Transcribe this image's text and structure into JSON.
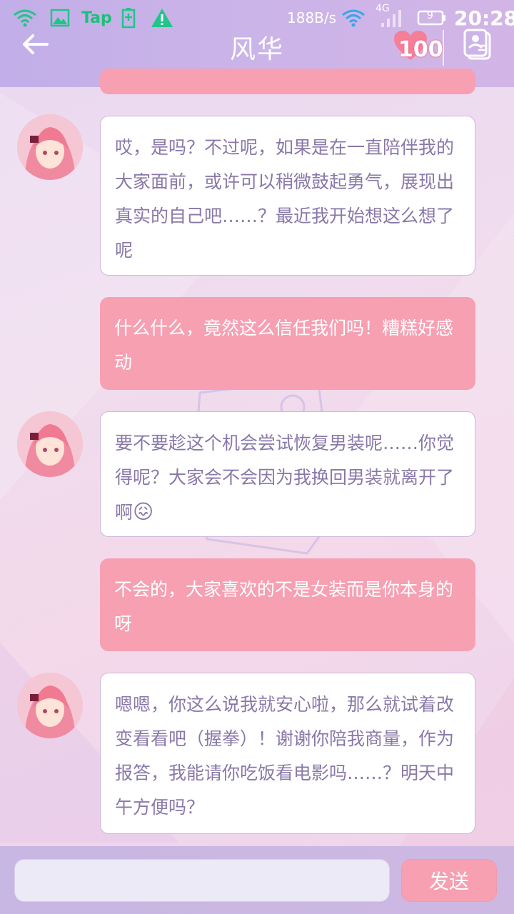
{
  "status_bar": {
    "tap_label": "Tap",
    "net_speed": "188B/s",
    "network_type": "4G",
    "battery_level": "9",
    "time": "20:28",
    "icons": [
      "wifi-icon",
      "image-icon",
      "tap-icon",
      "battery-charge-icon",
      "warning-icon",
      "wifi-icon",
      "signal-icon",
      "battery-icon"
    ]
  },
  "header": {
    "title": "风华",
    "heart_count": "100"
  },
  "messages": [
    {
      "side": "in",
      "text": "哎，是吗？不过呢，如果是在一直陪伴我的大家面前，或许可以稍微鼓起勇气，展现出真实的自己吧……？最近我开始想这么想了呢"
    },
    {
      "side": "out",
      "text": "什么什么，竟然这么信任我们吗！糟糕好感动"
    },
    {
      "side": "in",
      "text": "要不要趁这个机会尝试恢复男装呢……你觉得呢？大家会不会因为我换回男装就离开了啊",
      "emoji": "😖"
    },
    {
      "side": "out",
      "text": "不会的，大家喜欢的不是女装而是你本身的呀"
    },
    {
      "side": "in",
      "text": "嗯嗯，你这么说我就安心啦，那么就试着改变看看吧（握拳）！谢谢你陪我商量，作为报答，我能请你吃饭看电影吗……？明天中午方便吗？"
    }
  ],
  "input": {
    "value": "",
    "placeholder": ""
  },
  "send_label": "发送",
  "colors": {
    "header": "#c2aee8",
    "out_bubble": "#f6a0b2",
    "in_text": "#8a78a8",
    "send_button": "#f6a0b2"
  }
}
